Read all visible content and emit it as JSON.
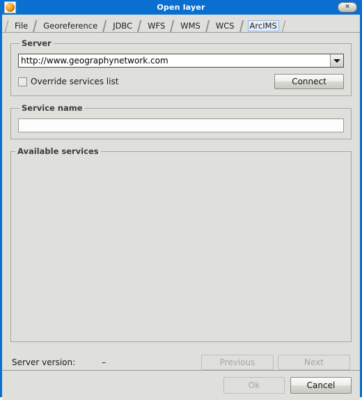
{
  "window": {
    "title": "Open layer",
    "icon": "app-globe-icon",
    "close_label": "✕",
    "accent_color": "#0a6fd0",
    "background_color": "#dfdfdb"
  },
  "tabs": [
    {
      "label": "File",
      "selected": false
    },
    {
      "label": "Georeference",
      "selected": false
    },
    {
      "label": "JDBC",
      "selected": false
    },
    {
      "label": "WFS",
      "selected": false
    },
    {
      "label": "WMS",
      "selected": false
    },
    {
      "label": "WCS",
      "selected": false
    },
    {
      "label": "ArcIMS",
      "selected": true
    }
  ],
  "server_group": {
    "legend": "Server",
    "url_value": "http://www.geographynetwork.com",
    "url_placeholder": "",
    "dropdown_icon": "chevron-down-icon",
    "override_checkbox": {
      "label": "Override services list",
      "checked": false
    },
    "connect_button": {
      "label": "Connect",
      "enabled": true
    }
  },
  "service_name_group": {
    "legend": "Service name",
    "value": "",
    "placeholder": ""
  },
  "available_services_group": {
    "legend": "Available services",
    "items": []
  },
  "status": {
    "label": "Server version:",
    "value": "–"
  },
  "pager": {
    "previous": {
      "label": "Previous",
      "enabled": false
    },
    "next": {
      "label": "Next",
      "enabled": false
    }
  },
  "footer": {
    "ok": {
      "label": "Ok",
      "enabled": false
    },
    "cancel": {
      "label": "Cancel",
      "enabled": true
    }
  }
}
